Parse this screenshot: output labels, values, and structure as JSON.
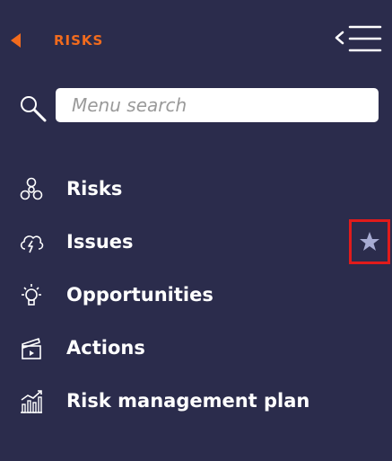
{
  "header": {
    "back_label": "RISKS"
  },
  "search": {
    "placeholder": "Menu search",
    "value": ""
  },
  "menu": {
    "items": [
      {
        "label": "Risks",
        "icon": "risk-icon"
      },
      {
        "label": "Issues",
        "icon": "issue-icon",
        "favorite": true
      },
      {
        "label": "Opportunities",
        "icon": "lightbulb-icon"
      },
      {
        "label": "Actions",
        "icon": "clapperboard-icon"
      },
      {
        "label": "Risk management plan",
        "icon": "chart-plan-icon"
      }
    ]
  },
  "colors": {
    "panel_bg": "#2b2c4c",
    "accent": "#f26b1d",
    "text": "#ffffff",
    "highlight": "#e11b1b",
    "star": "#a7abd3"
  }
}
